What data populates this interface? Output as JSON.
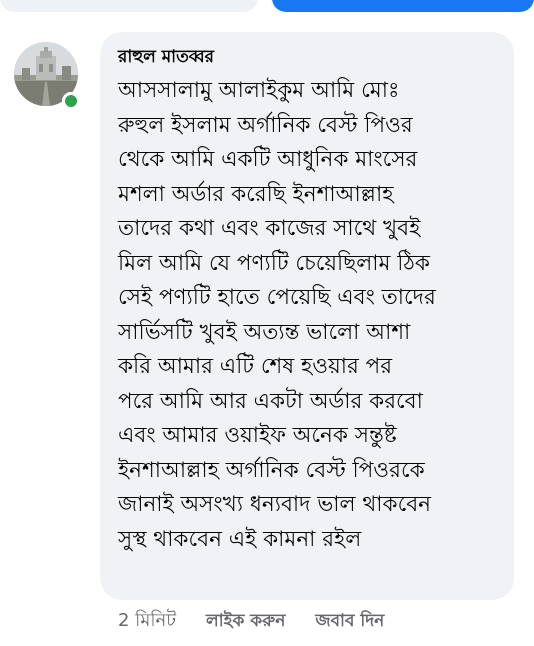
{
  "comment": {
    "author": "রাহুল মাতব্বর",
    "text": "আসসালামু আলাইকুম আমি মোঃ\nরুহুল ইসলাম অর্গানিক বেস্ট পিওর\nথেকে আমি একটি আধুনিক মাংসের\nমশলা অর্ডার করেছি ইনশাআল্লাহ\nতাদের কথা এবং কাজের সাথে খুবই\nমিল আমি যে পণ্যটি চেয়েছিলাম ঠিক\nসেই পণ্যটি হাতে পেয়েছি এবং তাদের\nসার্ভিসটি খুবই অত্যন্ত ভালো আশা\nকরি আমার এটি শেষ হওয়ার পর\nপরে আমি আর একটা অর্ডার করবো\nএবং আমার ওয়াইফ অনেক সন্তুষ্ট\nইনশাআল্লাহ অর্গানিক বেস্ট পিওরকে\nজানাই অসংখ্য ধন্যবাদ ভাল থাকবেন\nসুস্থ থাকবেন এই কামনা রইল",
    "online_status_color": "#31a24c",
    "avatar_icon": "profile-photo"
  },
  "actions": {
    "time": "2 মিনিট",
    "like": "লাইক করুন",
    "reply": "জবাব দিন"
  },
  "colors": {
    "bubble": "#f0f2f5",
    "accent": "#1877f2",
    "meta_text": "#65676b"
  }
}
